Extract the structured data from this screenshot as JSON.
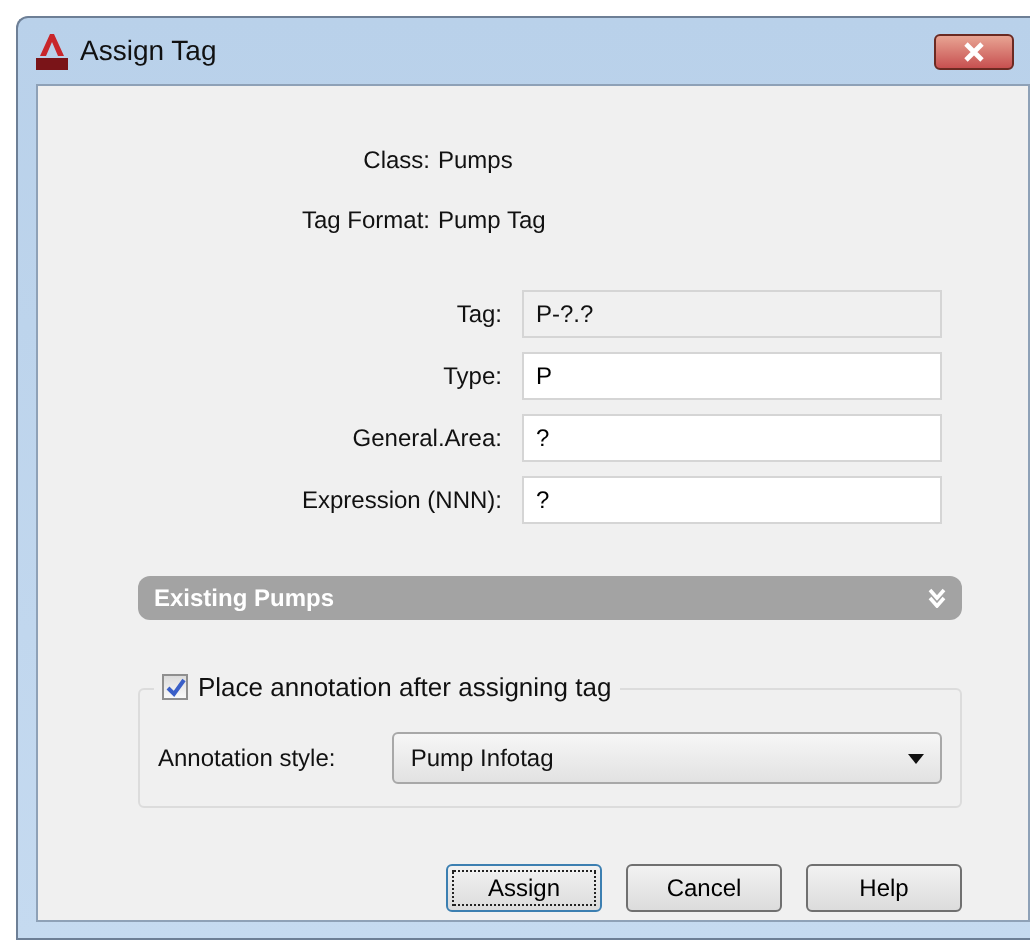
{
  "window": {
    "title": "Assign Tag"
  },
  "info": [
    {
      "label": "Class:",
      "value": "Pumps"
    },
    {
      "label": "Tag Format:",
      "value": "Pump Tag"
    }
  ],
  "fields": [
    {
      "label": "Tag:",
      "value": "P-?.?",
      "disabled": true
    },
    {
      "label": "Type:",
      "value": "P",
      "disabled": false
    },
    {
      "label": "General.Area:",
      "value": "?",
      "disabled": false
    },
    {
      "label": "Expression (NNN):",
      "value": "?",
      "disabled": false
    }
  ],
  "existing_panel": {
    "title": "Existing Pumps",
    "expanded": false
  },
  "annotation": {
    "checkbox_label": "Place annotation after assigning tag",
    "checked": true,
    "style_label": "Annotation style:",
    "style_value": "Pump Infotag"
  },
  "buttons": [
    {
      "label": "Assign",
      "focused": true
    },
    {
      "label": "Cancel",
      "focused": false
    },
    {
      "label": "Help",
      "focused": false
    }
  ]
}
